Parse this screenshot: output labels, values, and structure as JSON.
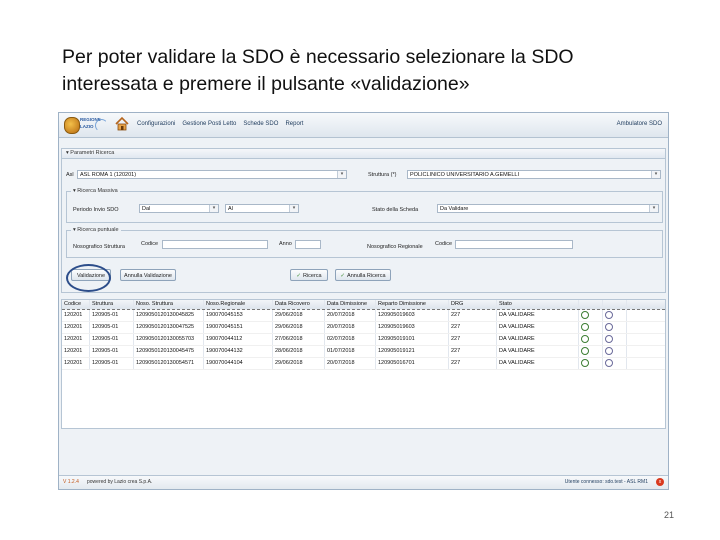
{
  "slide": {
    "title_line1": "Per poter validare la SDO è necessario selezionare la SDO",
    "title_line2": "interessata e premere il pulsante «validazione»",
    "page_number": "21"
  },
  "app": {
    "logo_line1": "REGIONE",
    "logo_line2": "LAZIO",
    "menu": [
      "Configurazioni",
      "Gestione Posti Letto",
      "Schede SDO",
      "Report"
    ],
    "user_area": "Ambulatore SDO"
  },
  "search": {
    "panel_title": "▾ Parametri Ricerca",
    "asl_label": "Asl",
    "asl_value": "ASL ROMA 1 (120201)",
    "struttura_label": "Struttura (*)",
    "struttura_value": "POLICLINICO UNIVERSITARIO A.GEMELLI",
    "ricerca_massiva_legend": "▾ Ricerca Massiva",
    "periodo_label": "Periodo Invio SDO",
    "dal_label": "Dal",
    "al_label": "Al",
    "stato_label": "Stato della Scheda",
    "stato_value": "Da Validare",
    "ricerca_puntuale_legend": "▾ Ricerca puntuale",
    "nosografico_label": "Nosografico Struttura",
    "codice_label": "Codice",
    "anno_label": "Anno",
    "nosografico_regionale_label": "Nosografico Regionale",
    "codice2_label": "Codice"
  },
  "buttons": {
    "validazione": "Validazione",
    "annulla_validazione": "Annulla Validazione",
    "ricerca": "Ricerca",
    "annulla_ricerca": "Annulla Ricerca"
  },
  "table": {
    "columns": [
      "Codice",
      "Struttura",
      "Noso. Struttura",
      "Noso.Regionale",
      "Data Ricovero",
      "Data Dimissione",
      "Reparto Dimissione",
      "DRG",
      "Stato",
      "",
      ""
    ],
    "rows": [
      [
        "120201",
        "120905-01",
        "1209050120130045825",
        "190070045153",
        "29/06/2018",
        "20/07/2018",
        "120905019603",
        "227",
        "DA VALIDARE"
      ],
      [
        "120201",
        "120905-01",
        "1209050120130047525",
        "190070045151",
        "29/06/2018",
        "20/07/2018",
        "120905019603",
        "227",
        "DA VALIDARE"
      ],
      [
        "120201",
        "120905-01",
        "1209050120130055703",
        "190070044112",
        "27/06/2018",
        "02/07/2018",
        "120905019101",
        "227",
        "DA VALIDARE"
      ],
      [
        "120201",
        "120905-01",
        "1209050120130045475",
        "190070044132",
        "28/06/2018",
        "01/07/2018",
        "120905019121",
        "227",
        "DA VALIDARE"
      ],
      [
        "120201",
        "120905-01",
        "1209050120130054571",
        "190070044104",
        "29/06/2018",
        "20/07/2018",
        "120905016701",
        "227",
        "DA VALIDARE"
      ]
    ]
  },
  "footer": {
    "version": "V 1.2.4",
    "powered": "powered by Lazio crea S.p.A.",
    "connected": "Utente connesso: sdo.test - ASL RM1",
    "close": "x"
  },
  "colors": {
    "highlight_ring": "#2c4d8a",
    "status_accent": "#c2571b"
  }
}
